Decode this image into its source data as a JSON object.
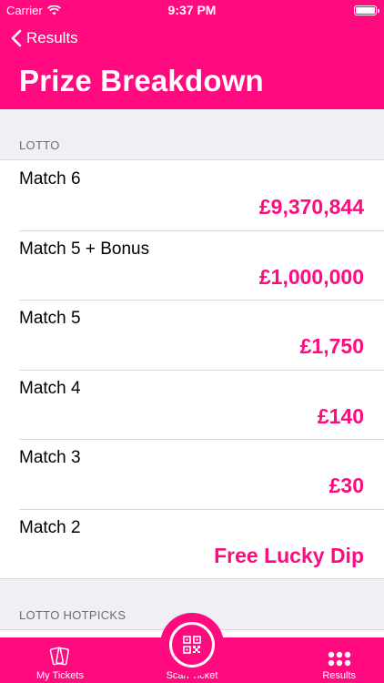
{
  "status": {
    "carrier": "Carrier",
    "time": "9:37 PM"
  },
  "nav": {
    "back_label": "Results",
    "title": "Prize Breakdown"
  },
  "sections": [
    {
      "label": "LOTTO",
      "rows": [
        {
          "name": "Match 6",
          "prize": "£9,370,844"
        },
        {
          "name": "Match 5 + Bonus",
          "prize": "£1,000,000"
        },
        {
          "name": "Match 5",
          "prize": "£1,750"
        },
        {
          "name": "Match 4",
          "prize": "£140"
        },
        {
          "name": "Match 3",
          "prize": "£30"
        },
        {
          "name": "Match 2",
          "prize": "Free Lucky Dip"
        }
      ]
    },
    {
      "label": "LOTTO HOTPICKS",
      "rows": []
    }
  ],
  "tabs": {
    "left": "My Tickets",
    "center": "Scan Ticket",
    "right": "Results"
  },
  "colors": {
    "accent": "#ff0a7f",
    "background": "#efeff4"
  },
  "icons": {
    "back": "chevron-left-icon",
    "wifi": "wifi-icon",
    "battery": "battery-icon",
    "tickets": "tickets-icon",
    "scan": "qr-code-icon",
    "results": "grid-dots-icon"
  }
}
